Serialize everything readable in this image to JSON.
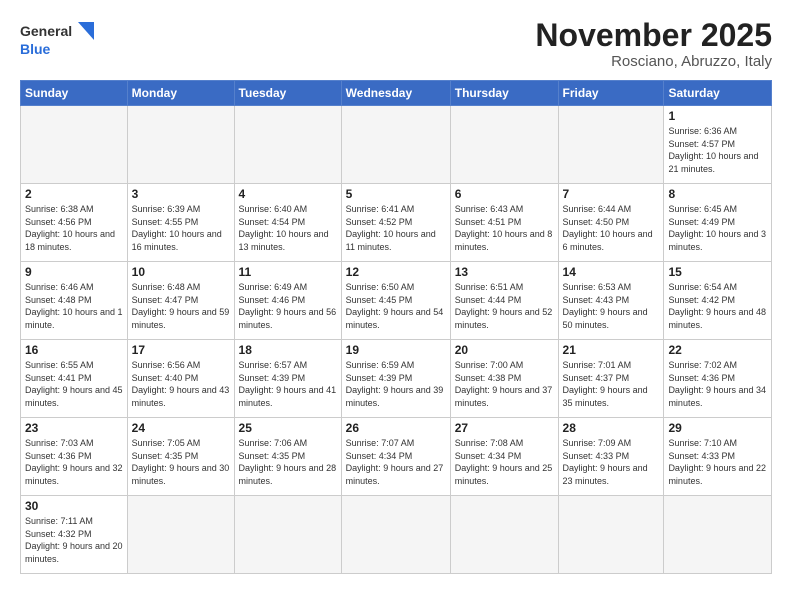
{
  "header": {
    "logo_general": "General",
    "logo_blue": "Blue",
    "month_title": "November 2025",
    "location": "Rosciano, Abruzzo, Italy"
  },
  "weekdays": [
    "Sunday",
    "Monday",
    "Tuesday",
    "Wednesday",
    "Thursday",
    "Friday",
    "Saturday"
  ],
  "rows": [
    [
      {
        "day": "",
        "info": ""
      },
      {
        "day": "",
        "info": ""
      },
      {
        "day": "",
        "info": ""
      },
      {
        "day": "",
        "info": ""
      },
      {
        "day": "",
        "info": ""
      },
      {
        "day": "",
        "info": ""
      },
      {
        "day": "1",
        "info": "Sunrise: 6:36 AM\nSunset: 4:57 PM\nDaylight: 10 hours and 21 minutes."
      }
    ],
    [
      {
        "day": "2",
        "info": "Sunrise: 6:38 AM\nSunset: 4:56 PM\nDaylight: 10 hours and 18 minutes."
      },
      {
        "day": "3",
        "info": "Sunrise: 6:39 AM\nSunset: 4:55 PM\nDaylight: 10 hours and 16 minutes."
      },
      {
        "day": "4",
        "info": "Sunrise: 6:40 AM\nSunset: 4:54 PM\nDaylight: 10 hours and 13 minutes."
      },
      {
        "day": "5",
        "info": "Sunrise: 6:41 AM\nSunset: 4:52 PM\nDaylight: 10 hours and 11 minutes."
      },
      {
        "day": "6",
        "info": "Sunrise: 6:43 AM\nSunset: 4:51 PM\nDaylight: 10 hours and 8 minutes."
      },
      {
        "day": "7",
        "info": "Sunrise: 6:44 AM\nSunset: 4:50 PM\nDaylight: 10 hours and 6 minutes."
      },
      {
        "day": "8",
        "info": "Sunrise: 6:45 AM\nSunset: 4:49 PM\nDaylight: 10 hours and 3 minutes."
      }
    ],
    [
      {
        "day": "9",
        "info": "Sunrise: 6:46 AM\nSunset: 4:48 PM\nDaylight: 10 hours and 1 minute."
      },
      {
        "day": "10",
        "info": "Sunrise: 6:48 AM\nSunset: 4:47 PM\nDaylight: 9 hours and 59 minutes."
      },
      {
        "day": "11",
        "info": "Sunrise: 6:49 AM\nSunset: 4:46 PM\nDaylight: 9 hours and 56 minutes."
      },
      {
        "day": "12",
        "info": "Sunrise: 6:50 AM\nSunset: 4:45 PM\nDaylight: 9 hours and 54 minutes."
      },
      {
        "day": "13",
        "info": "Sunrise: 6:51 AM\nSunset: 4:44 PM\nDaylight: 9 hours and 52 minutes."
      },
      {
        "day": "14",
        "info": "Sunrise: 6:53 AM\nSunset: 4:43 PM\nDaylight: 9 hours and 50 minutes."
      },
      {
        "day": "15",
        "info": "Sunrise: 6:54 AM\nSunset: 4:42 PM\nDaylight: 9 hours and 48 minutes."
      }
    ],
    [
      {
        "day": "16",
        "info": "Sunrise: 6:55 AM\nSunset: 4:41 PM\nDaylight: 9 hours and 45 minutes."
      },
      {
        "day": "17",
        "info": "Sunrise: 6:56 AM\nSunset: 4:40 PM\nDaylight: 9 hours and 43 minutes."
      },
      {
        "day": "18",
        "info": "Sunrise: 6:57 AM\nSunset: 4:39 PM\nDaylight: 9 hours and 41 minutes."
      },
      {
        "day": "19",
        "info": "Sunrise: 6:59 AM\nSunset: 4:39 PM\nDaylight: 9 hours and 39 minutes."
      },
      {
        "day": "20",
        "info": "Sunrise: 7:00 AM\nSunset: 4:38 PM\nDaylight: 9 hours and 37 minutes."
      },
      {
        "day": "21",
        "info": "Sunrise: 7:01 AM\nSunset: 4:37 PM\nDaylight: 9 hours and 35 minutes."
      },
      {
        "day": "22",
        "info": "Sunrise: 7:02 AM\nSunset: 4:36 PM\nDaylight: 9 hours and 34 minutes."
      }
    ],
    [
      {
        "day": "23",
        "info": "Sunrise: 7:03 AM\nSunset: 4:36 PM\nDaylight: 9 hours and 32 minutes."
      },
      {
        "day": "24",
        "info": "Sunrise: 7:05 AM\nSunset: 4:35 PM\nDaylight: 9 hours and 30 minutes."
      },
      {
        "day": "25",
        "info": "Sunrise: 7:06 AM\nSunset: 4:35 PM\nDaylight: 9 hours and 28 minutes."
      },
      {
        "day": "26",
        "info": "Sunrise: 7:07 AM\nSunset: 4:34 PM\nDaylight: 9 hours and 27 minutes."
      },
      {
        "day": "27",
        "info": "Sunrise: 7:08 AM\nSunset: 4:34 PM\nDaylight: 9 hours and 25 minutes."
      },
      {
        "day": "28",
        "info": "Sunrise: 7:09 AM\nSunset: 4:33 PM\nDaylight: 9 hours and 23 minutes."
      },
      {
        "day": "29",
        "info": "Sunrise: 7:10 AM\nSunset: 4:33 PM\nDaylight: 9 hours and 22 minutes."
      }
    ],
    [
      {
        "day": "30",
        "info": "Sunrise: 7:11 AM\nSunset: 4:32 PM\nDaylight: 9 hours and 20 minutes."
      },
      {
        "day": "",
        "info": ""
      },
      {
        "day": "",
        "info": ""
      },
      {
        "day": "",
        "info": ""
      },
      {
        "day": "",
        "info": ""
      },
      {
        "day": "",
        "info": ""
      },
      {
        "day": "",
        "info": ""
      }
    ]
  ]
}
